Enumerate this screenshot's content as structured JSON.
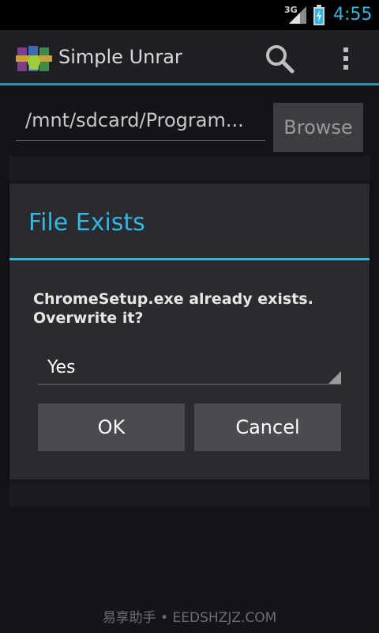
{
  "status_bar": {
    "network": "3G",
    "time": "4:55"
  },
  "action_bar": {
    "app_title": "Simple Unrar",
    "icons": [
      "app-logo-icon",
      "search-icon",
      "overflow-menu-icon"
    ]
  },
  "main": {
    "path_value": "/mnt/sdcard/Program...",
    "browse_label": "Browse"
  },
  "dialog": {
    "title": "File Exists",
    "message_line1": "ChromeSetup.exe already exists.",
    "message_line2": "Overwrite it?",
    "spinner_value": "Yes",
    "ok_label": "OK",
    "cancel_label": "Cancel"
  },
  "watermark": "易享助手 • EEDSHZJZ.COM",
  "colors": {
    "accent": "#33b5e5",
    "background": "#141518",
    "dialog": "#2a2b2e",
    "button": "#4a4b4e"
  }
}
